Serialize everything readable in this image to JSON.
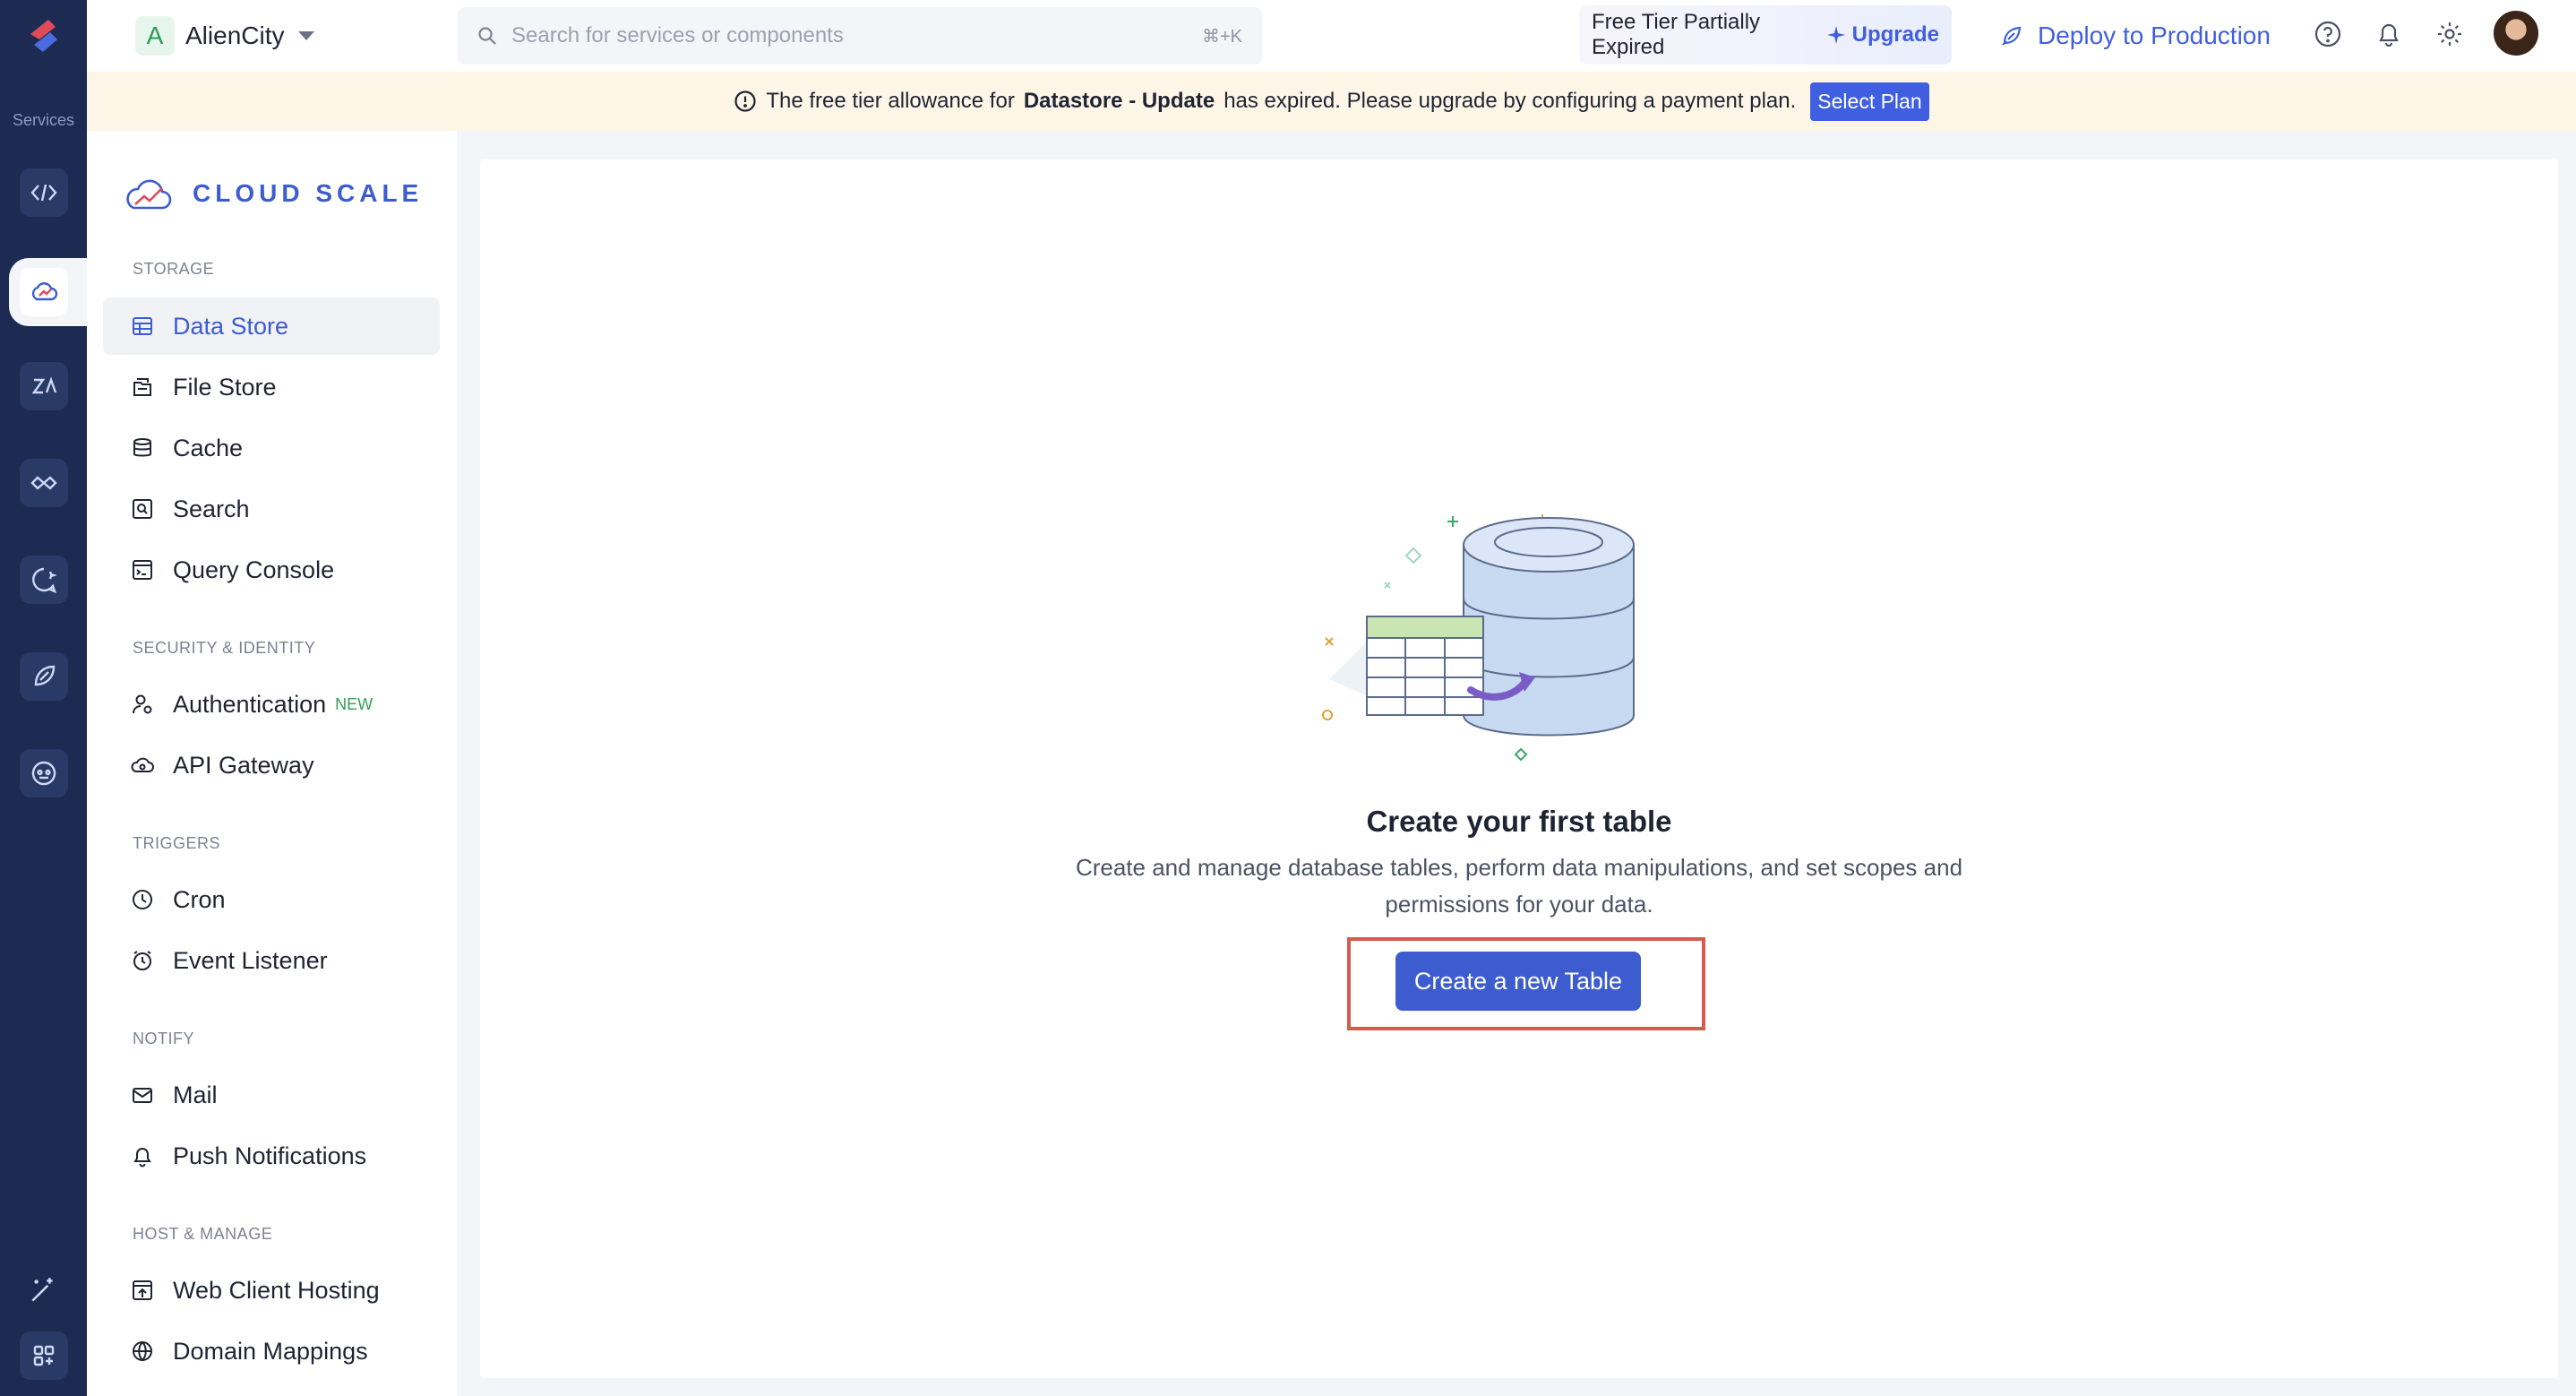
{
  "rail": {
    "services_label": "Services"
  },
  "topbar": {
    "project_initial": "A",
    "project_name": "AlienCity",
    "search_placeholder": "Search for services or components",
    "search_shortcut": "⌘+K",
    "tier_status": "Free Tier Partially Expired",
    "upgrade_label": "Upgrade",
    "deploy_label": "Deploy to Production"
  },
  "banner": {
    "prefix": "The free tier allowance for",
    "service": "Datastore - Update",
    "suffix": "has expired. Please upgrade by configuring a payment plan.",
    "button": "Select Plan"
  },
  "sidebar": {
    "brand": "CLOUD SCALE",
    "sections": [
      {
        "title": "STORAGE",
        "items": [
          "Data Store",
          "File Store",
          "Cache",
          "Search",
          "Query Console"
        ]
      },
      {
        "title": "SECURITY & IDENTITY",
        "items": [
          "Authentication",
          "API Gateway"
        ],
        "badge": "NEW"
      },
      {
        "title": "TRIGGERS",
        "items": [
          "Cron",
          "Event Listener"
        ]
      },
      {
        "title": "NOTIFY",
        "items": [
          "Mail",
          "Push Notifications"
        ]
      },
      {
        "title": "HOST & MANAGE",
        "items": [
          "Web Client Hosting",
          "Domain Mappings"
        ]
      }
    ]
  },
  "main": {
    "title": "Create your first table",
    "description": "Create and manage database tables, perform data manipulations, and set scopes and permissions for your data.",
    "cta": "Create a new Table"
  },
  "colors": {
    "rail": "#1d2b52",
    "accent": "#3c5ccf",
    "banner_bg": "#fdf5e6",
    "highlight_outline": "#d65a4d",
    "new_badge": "#2fa05a"
  }
}
